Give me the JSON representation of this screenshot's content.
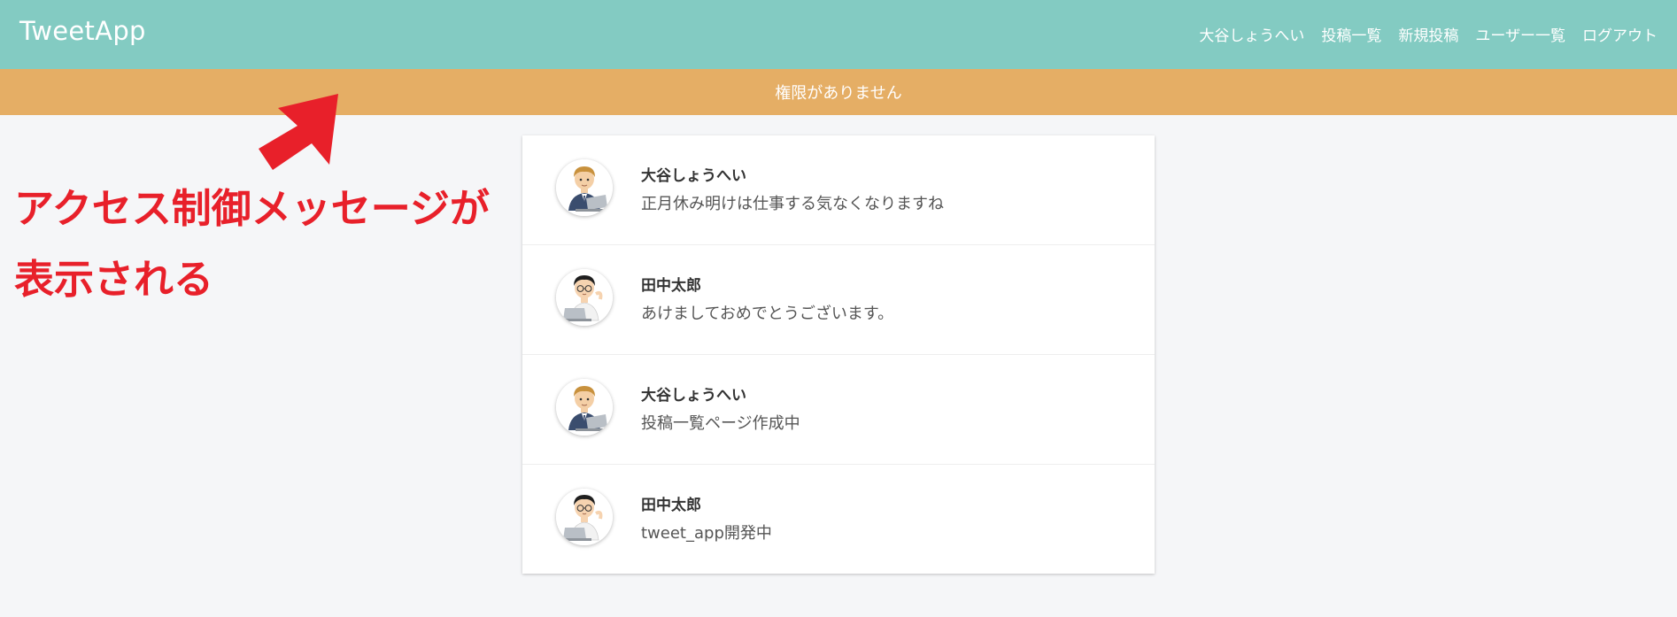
{
  "app": {
    "logo": "TweetApp"
  },
  "nav": {
    "items": [
      {
        "label": "大谷しょうへい"
      },
      {
        "label": "投稿一覧"
      },
      {
        "label": "新規投稿"
      },
      {
        "label": "ユーザー一覧"
      },
      {
        "label": "ログアウト"
      }
    ]
  },
  "flash": {
    "message": "権限がありません"
  },
  "annotation": {
    "line1": "アクセス制御メッセージが",
    "line2": "表示される"
  },
  "posts": [
    {
      "user": "大谷しょうへい",
      "text": "正月休み明けは仕事する気なくなりますね",
      "avatar_icon": "businessman-laptop-icon"
    },
    {
      "user": "田中太郎",
      "text": "あけましておめでとうございます。",
      "avatar_icon": "glasses-man-laptop-icon"
    },
    {
      "user": "大谷しょうへい",
      "text": "投稿一覧ページ作成中",
      "avatar_icon": "businessman-laptop-icon"
    },
    {
      "user": "田中太郎",
      "text": "tweet_app開発中",
      "avatar_icon": "glasses-man-laptop-icon"
    }
  ],
  "colors": {
    "header": "#83cbc2",
    "flash": "#e5ae65",
    "annotation": "#e8202a",
    "background": "#f5f6f8"
  }
}
